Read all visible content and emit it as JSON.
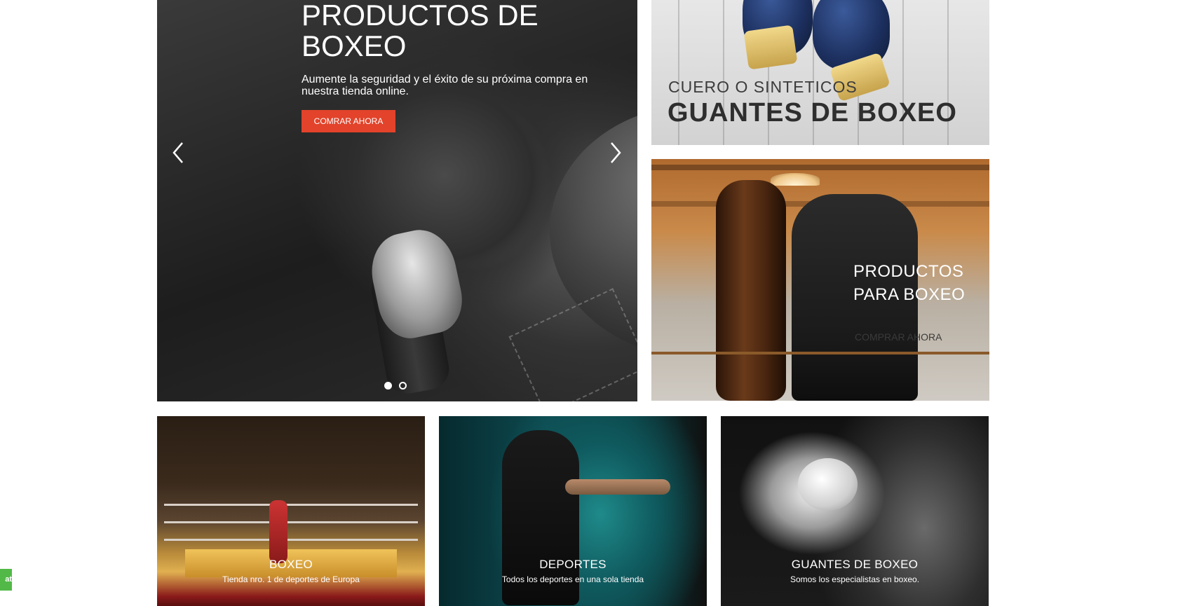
{
  "hero": {
    "title": "PRODUCTOS DE BOXEO",
    "subtitle": "Aumente la seguridad y el éxito de su próxima compra en nuestra tienda online.",
    "cta_label": "COMRAR AHORA",
    "prev_icon": "chevron-left-icon",
    "next_icon": "chevron-right-icon",
    "slides_total": 2,
    "active_slide": 1
  },
  "gloves_banner": {
    "kicker": "CUERO O SINTETICOS",
    "title": "GUANTES DE BOXEO"
  },
  "bag_banner": {
    "title": "PRODUCTOS PARA BOXEO",
    "link_label": "COMPRAR AHORA"
  },
  "tiles": [
    {
      "title": "BOXEO",
      "subtitle": "Tienda nro. 1 de deportes de Europa"
    },
    {
      "title": "DEPORTES",
      "subtitle": "Todos los deportes en una sola tienda"
    },
    {
      "title": "GUANTES DE BOXEO",
      "subtitle": "Somos los especialistas en boxeo."
    }
  ],
  "chat_tab": {
    "label": "at"
  },
  "colors": {
    "cta": "#e2432a",
    "chat": "#52b948"
  }
}
